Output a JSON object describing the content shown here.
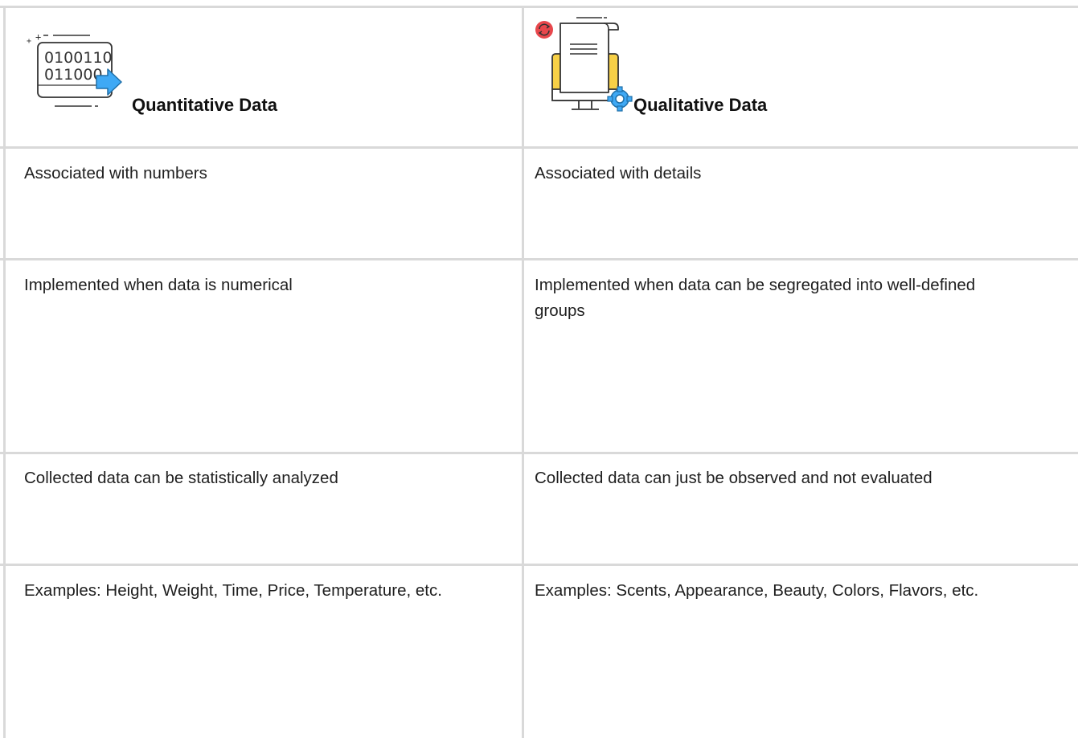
{
  "table": {
    "headers": [
      {
        "title": "Quantitative Data",
        "icon": "binary-data-icon"
      },
      {
        "title": "Qualitative Data",
        "icon": "document-monitor-icon"
      }
    ],
    "rows": [
      [
        "Associated with numbers",
        "Associated with details"
      ],
      [
        "Implemented when data is numerical",
        "Implemented when data can be segregated into well-defined groups"
      ],
      [
        "Collected data can be statistically analyzed",
        "Collected data can just be observed and not evaluated"
      ],
      [
        "Examples: Height, Weight, Time, Price, Temperature, etc.",
        "Examples: Scents, Appearance, Beauty, Colors, Flavors, etc."
      ]
    ]
  },
  "icons": {
    "binary_lines": [
      "0100110",
      "011000"
    ]
  },
  "colors": {
    "grid": "#d9d9d9",
    "accent_blue": "#3fa9f5",
    "accent_yellow": "#f7d046",
    "accent_red": "#e8474c"
  }
}
